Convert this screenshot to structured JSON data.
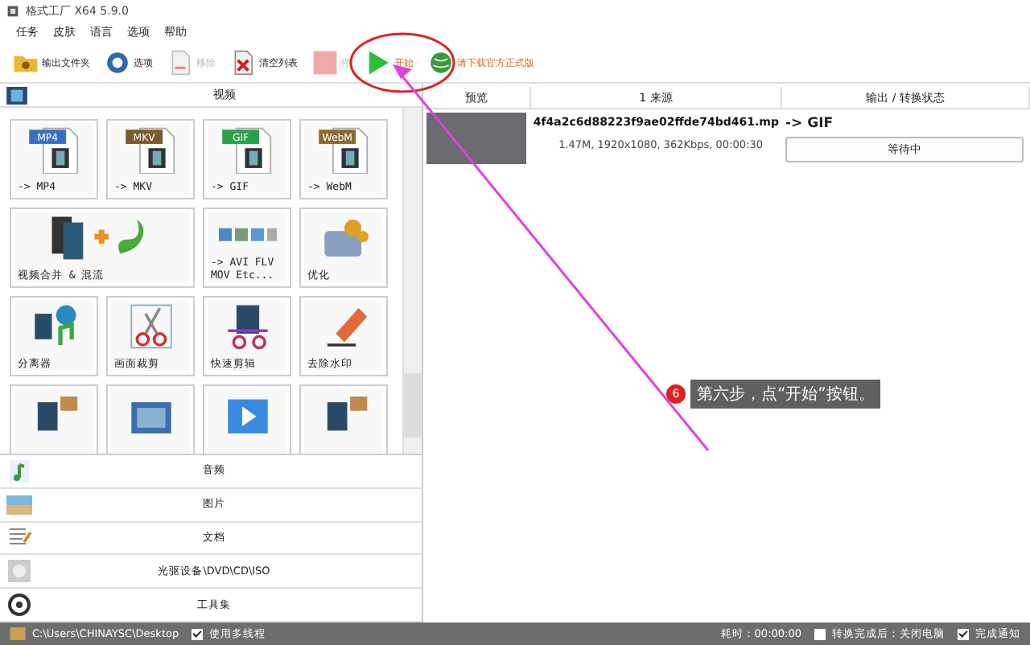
{
  "window": {
    "title": "格式工厂 X64 5.9.0"
  },
  "menu": [
    "任务",
    "皮肤",
    "语言",
    "选项",
    "帮助"
  ],
  "toolbar": [
    {
      "kind": "folder",
      "label": "输出文件夹",
      "disabled": false
    },
    {
      "kind": "options",
      "label": "选项",
      "disabled": false
    },
    {
      "kind": "remove",
      "label": "移除",
      "disabled": true
    },
    {
      "kind": "clear",
      "label": "清空列表",
      "disabled": false
    },
    {
      "kind": "stop",
      "label": "停",
      "disabled": true
    },
    {
      "kind": "start",
      "label": "开始",
      "disabled": false
    },
    {
      "kind": "download",
      "label": "请下载官方正式版",
      "disabled": false
    }
  ],
  "left_panel": {
    "header": "视频",
    "tiles": [
      {
        "kind": "format",
        "badge": "MP4",
        "label": "-> MP4",
        "color": "#3a6fc0"
      },
      {
        "kind": "format",
        "badge": "MKV",
        "label": "-> MKV",
        "color": "#7a5a2a"
      },
      {
        "kind": "format",
        "badge": "GIF",
        "label": "-> GIF",
        "color": "#2aa04a"
      },
      {
        "kind": "format",
        "badge": "WebM",
        "label": "-> WebM",
        "color": "#8a6a30"
      },
      {
        "kind": "merge",
        "label": "视频合并 & 混流"
      },
      {
        "kind": "multi",
        "label": "-> AVI FLV\nMOV Etc..."
      },
      {
        "kind": "optimize",
        "label": "优化"
      },
      {
        "kind": "split",
        "label": "分离器"
      },
      {
        "kind": "crop",
        "label": "画面裁剪"
      },
      {
        "kind": "cut",
        "label": "快速剪辑"
      },
      {
        "kind": "logo",
        "label": "去除水印"
      },
      {
        "kind": "film"
      },
      {
        "kind": "photo"
      },
      {
        "kind": "player"
      },
      {
        "kind": "film"
      }
    ],
    "categories": [
      {
        "kind": "audio",
        "label": "音频"
      },
      {
        "kind": "image",
        "label": "图片"
      },
      {
        "kind": "document",
        "label": "文档"
      },
      {
        "kind": "disc",
        "label": "光驱设备\\DVD\\CD\\ISO"
      },
      {
        "kind": "tools",
        "label": "工具集"
      }
    ]
  },
  "table": {
    "columns": [
      "预览",
      "1 来源",
      "输出 / 转换状态"
    ],
    "rows": [
      {
        "source": "4f4a2c6d88223f9ae02ffde74bd461.mp",
        "info": "1.47M, 1920x1080, 362Kbps, 00:00:30",
        "output": "-> GIF",
        "status": "等待中"
      }
    ]
  },
  "callout": {
    "step": "6",
    "text": "第六步，点“开始”按钮。"
  },
  "status_bar": {
    "path": "C:\\Users\\CHINAYSC\\Desktop",
    "multithread": {
      "label": "使用多线程",
      "checked": true
    },
    "elapsed": "耗时：00:00:00",
    "shutdown": {
      "label": "转换完成后：关闭电脑",
      "checked": false
    },
    "notify": {
      "label": "完成通知",
      "checked": true
    }
  }
}
